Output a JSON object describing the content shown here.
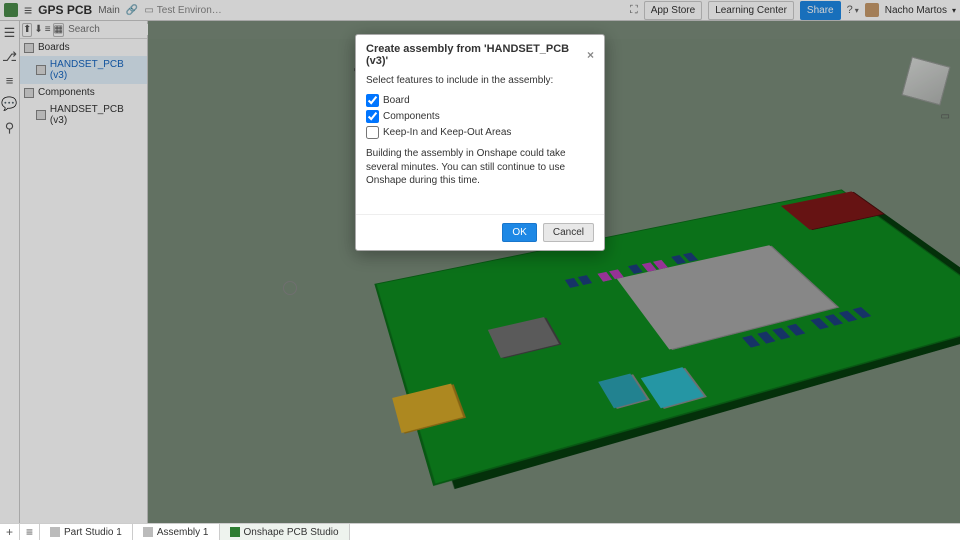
{
  "top": {
    "doc_name": "GPS PCB",
    "branch": "Main",
    "folder": "Test Environ…",
    "app_store": "App Store",
    "learning_center": "Learning Center",
    "share": "Share",
    "user": "Nacho Martos"
  },
  "search_placeholder": "Search",
  "tree": {
    "boards": "Boards",
    "handset_v3_active": "HANDSET_PCB (v3)",
    "components": "Components",
    "handset_v3": "HANDSET_PCB (v3)"
  },
  "dialog": {
    "title": "Create assembly from 'HANDSET_PCB (v3)'",
    "subtitle": "Select features to include in the assembly:",
    "board": "Board",
    "components": "Components",
    "keep": "Keep-In and Keep-Out Areas",
    "note": "Building the assembly in Onshape could take several minutes. You can still continue to use Onshape during this time.",
    "ok": "OK",
    "cancel": "Cancel"
  },
  "tabs": {
    "part_studio": "Part Studio 1",
    "assembly": "Assembly 1",
    "pcb_studio": "Onshape PCB Studio"
  }
}
